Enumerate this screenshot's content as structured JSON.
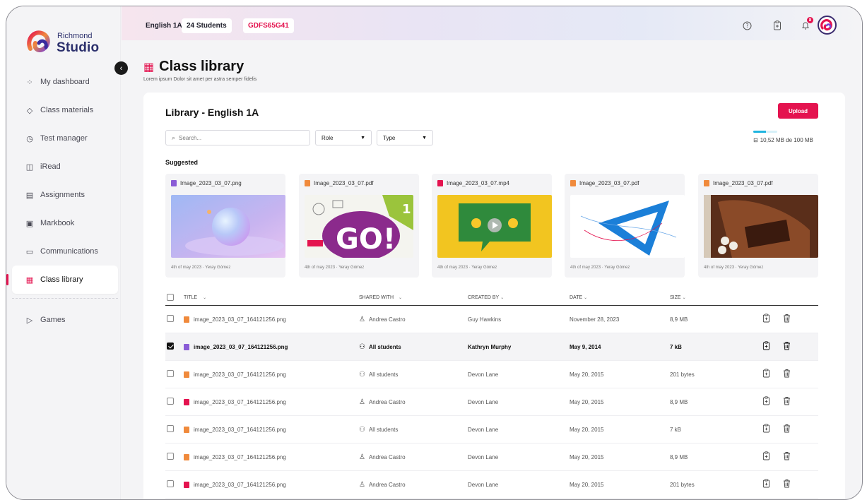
{
  "brand": {
    "line1": "Richmond",
    "line2": "Studio"
  },
  "sidebar": {
    "items": [
      {
        "label": "My dashboard",
        "icon": "grid-icon"
      },
      {
        "label": "Class materials",
        "icon": "layers-icon"
      },
      {
        "label": "Test manager",
        "icon": "clock-icon"
      },
      {
        "label": "iRead",
        "icon": "book-icon"
      },
      {
        "label": "Assignments",
        "icon": "clipboard-icon"
      },
      {
        "label": "Markbook",
        "icon": "notebook-icon"
      },
      {
        "label": "Communications",
        "icon": "chat-icon"
      },
      {
        "label": "Class library",
        "icon": "library-icon",
        "active": true
      },
      {
        "label": "Games",
        "icon": "play-icon"
      }
    ]
  },
  "topbar": {
    "class_name": "English 1A",
    "students": "24 Students",
    "code": "GDFS65G41",
    "notifications": "8"
  },
  "page": {
    "title": "Class library",
    "subtitle": "Lorem ipsum Dolor sit amet per astra semper fidelis"
  },
  "library": {
    "title": "Library - English 1A",
    "upload_label": "Upload",
    "search_placeholder": "Search...",
    "role_label": "Role",
    "type_label": "Type",
    "storage_text": "10,52 MB de 100 MB",
    "storage_fraction": 0.1052,
    "suggested_title": "Suggested"
  },
  "suggested": [
    {
      "name": "Image_2023_03_07.png",
      "type": "image",
      "meta": "4th of may 2023 · Yeray Gómez"
    },
    {
      "name": "Image_2023_03_07.pdf",
      "type": "pdf",
      "meta": "4th of may 2023 · Yeray Gómez"
    },
    {
      "name": "Image_2023_03_07.mp4",
      "type": "video",
      "meta": "4th of may 2023 · Yeray Gómez"
    },
    {
      "name": "Image_2023_03_07.pdf",
      "type": "pdf",
      "meta": "4th of may 2023 · Yeray Gómez"
    },
    {
      "name": "Image_2023_03_07.pdf",
      "type": "pdf",
      "meta": "4th of may 2023 · Yeray Gómez"
    }
  ],
  "table": {
    "headers": {
      "title": "TITLE",
      "shared": "SHARED WITH",
      "created": "CREATED BY",
      "date": "DATE",
      "size": "SIZE"
    },
    "rows": [
      {
        "type": "pdf",
        "title": "image_2023_03_07_164121256.png",
        "shared": "Andrea Castro",
        "shared_icon": "user-icon",
        "created": "Guy Hawkins",
        "date": "November 28, 2023",
        "size": "8,9 MB",
        "checked": false
      },
      {
        "type": "image",
        "title": "image_2023_03_07_164121256.png",
        "shared": "All students",
        "shared_icon": "group-icon",
        "created": "Kathryn Murphy",
        "date": "May 9, 2014",
        "size": "7 kB",
        "checked": true
      },
      {
        "type": "pdf",
        "title": "image_2023_03_07_164121256.png",
        "shared": "All students",
        "shared_icon": "group-icon",
        "created": "Devon Lane",
        "date": "May 20, 2015",
        "size": "201 bytes",
        "checked": false
      },
      {
        "type": "video",
        "title": "image_2023_03_07_164121256.png",
        "shared": "Andrea Castro",
        "shared_icon": "user-icon",
        "created": "Devon Lane",
        "date": "May 20, 2015",
        "size": "8,9 MB",
        "checked": false
      },
      {
        "type": "pdf",
        "title": "image_2023_03_07_164121256.png",
        "shared": "All students",
        "shared_icon": "group-icon",
        "created": "Devon Lane",
        "date": "May 20, 2015",
        "size": "7 kB",
        "checked": false
      },
      {
        "type": "pdf",
        "title": "image_2023_03_07_164121256.png",
        "shared": "Andrea Castro",
        "shared_icon": "user-icon",
        "created": "Devon Lane",
        "date": "May 20, 2015",
        "size": "8,9 MB",
        "checked": false
      },
      {
        "type": "video",
        "title": "image_2023_03_07_164121256.png",
        "shared": "Andrea Castro",
        "shared_icon": "user-icon",
        "created": "Devon Lane",
        "date": "May 20, 2015",
        "size": "201 bytes",
        "checked": false
      }
    ]
  },
  "colors": {
    "accent": "#e4134f",
    "image_type": "#8a5cd6",
    "pdf_type": "#f08a3c",
    "video_type": "#e4134f",
    "storage": "#1fb4df"
  }
}
